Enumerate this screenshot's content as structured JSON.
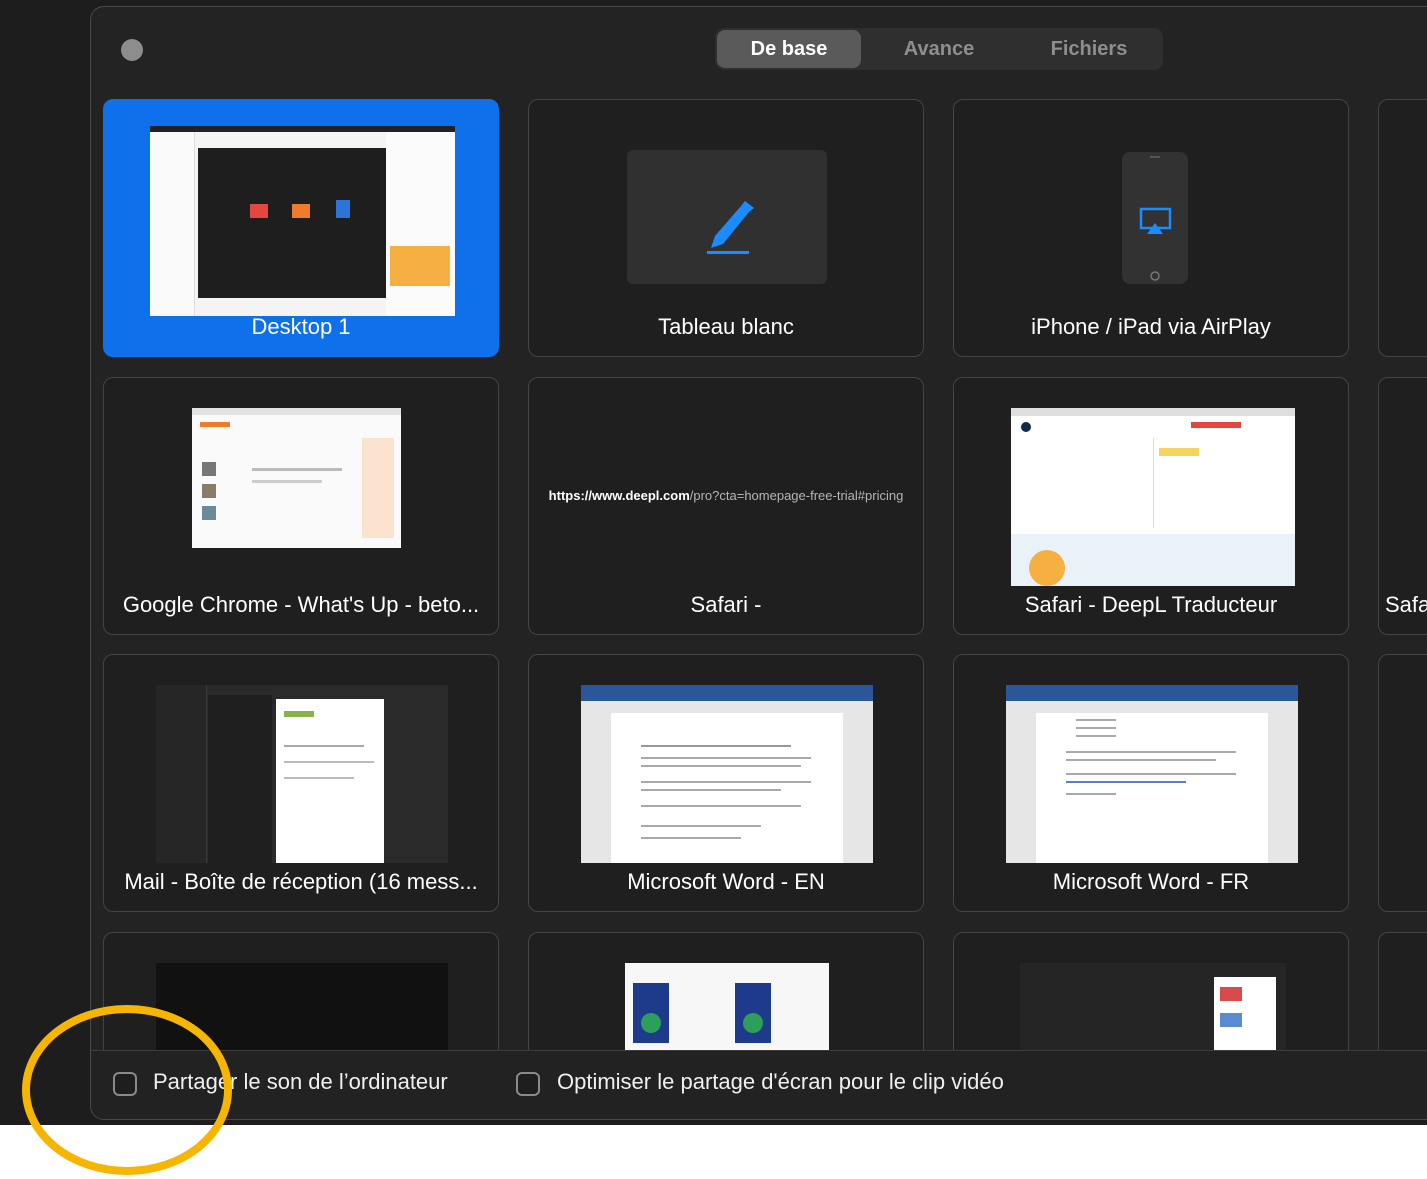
{
  "tabs": [
    {
      "label": "De base",
      "active": true
    },
    {
      "label": "Avance",
      "active": false
    },
    {
      "label": "Fichiers",
      "active": false
    }
  ],
  "tiles": {
    "desktop": "Desktop 1",
    "whiteboard": "Tableau blanc",
    "airplay": "iPhone / iPad via AirPlay",
    "chrome": "Google Chrome - What's Up - beto...",
    "safari_blank": "Safari -",
    "safari_url": "https://www.deepl.com/pro?cta=homepage-free-trial#pricing",
    "safari_url_domain": "https://www.deepl.com",
    "safari_url_rest": "/pro?cta=homepage-free-trial#pricing",
    "safari_deepl": "Safari - DeepL Traducteur",
    "safari_partial": "Safa",
    "mail": "Mail - Boîte de réception (16 mess...",
    "word_en": "Microsoft Word - EN",
    "word_fr": "Microsoft Word - FR"
  },
  "options": {
    "share_sound": "Partager le son de l’ordinateur",
    "optimize_video": "Optimiser le partage d'écran pour le clip vidéo"
  },
  "colors": {
    "accent": "#0e71eb",
    "highlight_circle": "#f6b500"
  },
  "icons": [
    "pencil-icon",
    "airplay-icon"
  ]
}
